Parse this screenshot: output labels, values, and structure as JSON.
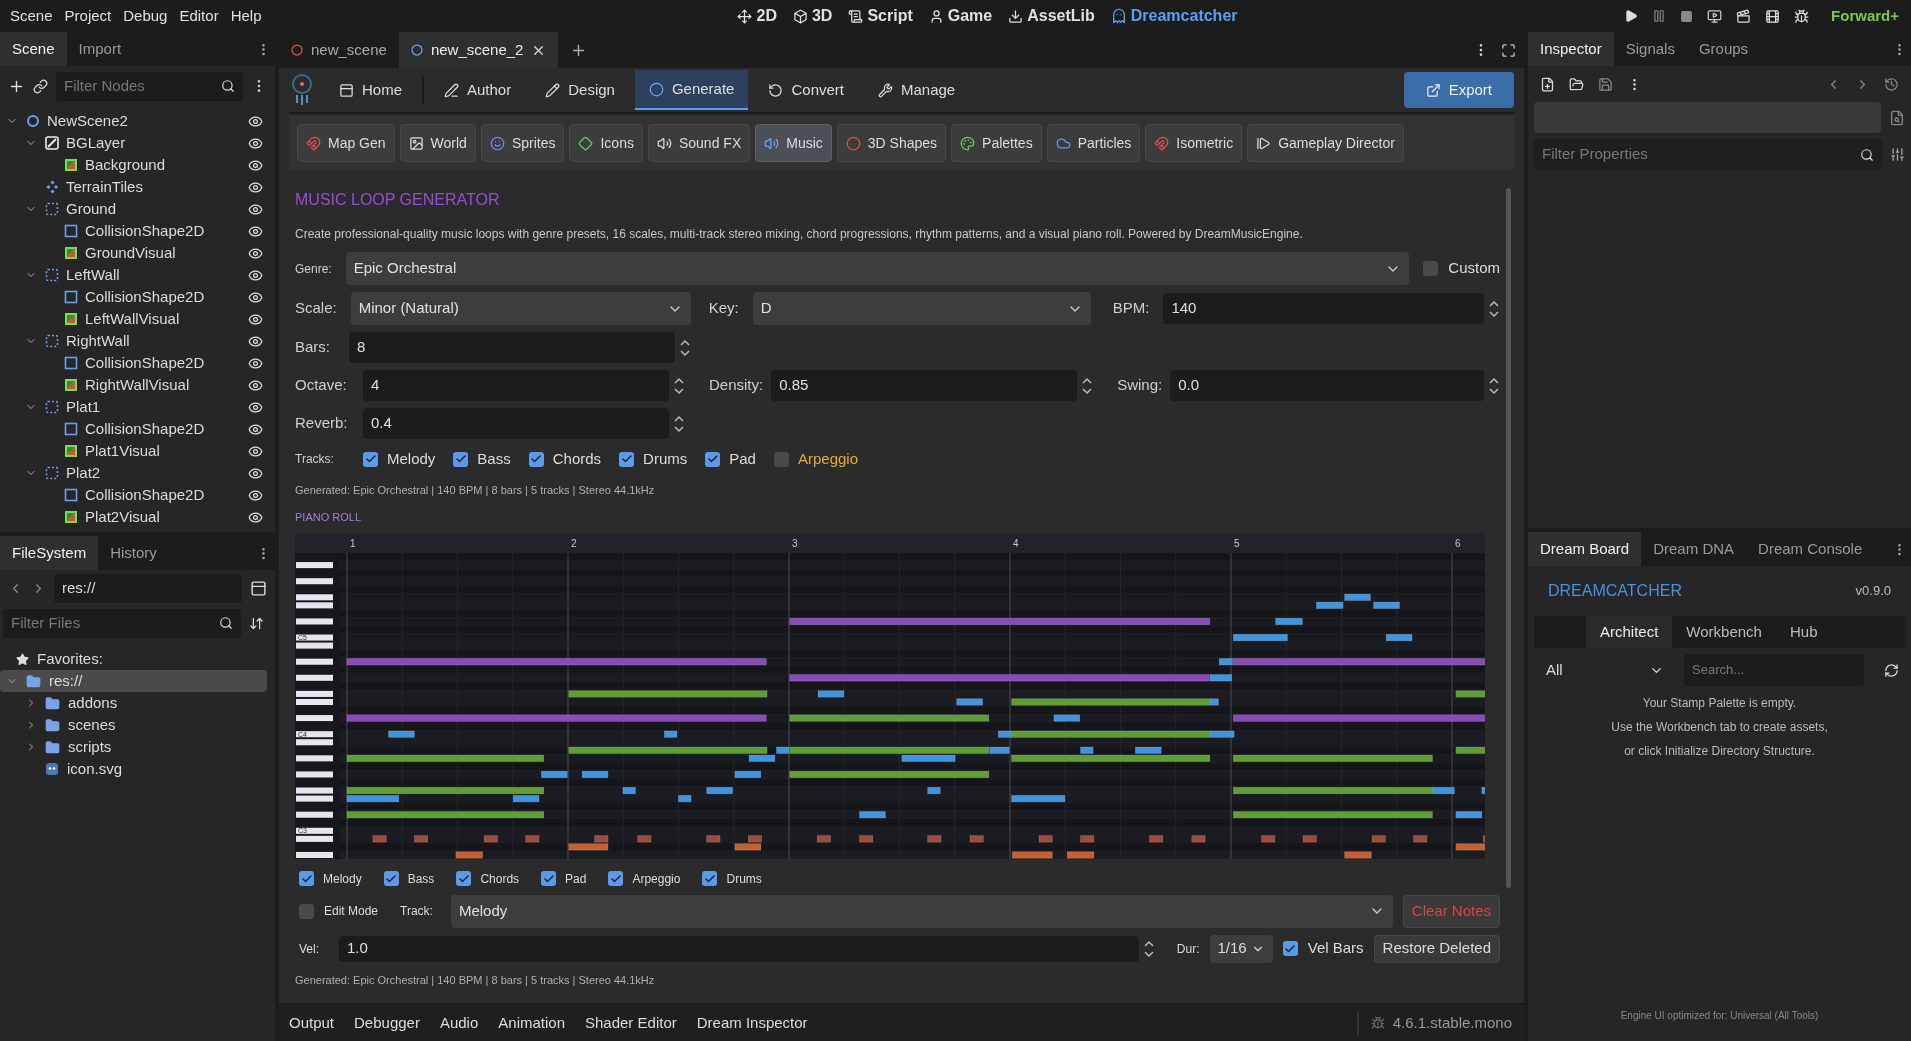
{
  "menu": [
    "Scene",
    "Project",
    "Debug",
    "Editor",
    "Help"
  ],
  "workspaces": [
    {
      "label": "2D",
      "selected": false
    },
    {
      "label": "3D",
      "selected": false
    },
    {
      "label": "Script",
      "selected": false
    },
    {
      "label": "Game",
      "selected": false
    },
    {
      "label": "AssetLib",
      "selected": false
    },
    {
      "label": "Dreamcatcher",
      "selected": true
    }
  ],
  "renderer": "Forward+",
  "scene_dock": {
    "tabs": [
      {
        "label": "Scene",
        "selected": true
      },
      {
        "label": "Import",
        "selected": false
      }
    ],
    "filter_placeholder": "Filter Nodes",
    "tree": [
      {
        "label": "NewScene2",
        "kind": "root",
        "expanded": true,
        "children": [
          {
            "label": "BGLayer",
            "kind": "layer",
            "expanded": true,
            "children": [
              {
                "label": "Background",
                "kind": "sprite"
              }
            ]
          },
          {
            "label": "TerrainTiles",
            "kind": "tilemap"
          },
          {
            "label": "Ground",
            "kind": "body",
            "expanded": true,
            "children": [
              {
                "label": "CollisionShape2D",
                "kind": "collision"
              },
              {
                "label": "GroundVisual",
                "kind": "sprite"
              }
            ]
          },
          {
            "label": "LeftWall",
            "kind": "body",
            "expanded": true,
            "children": [
              {
                "label": "CollisionShape2D",
                "kind": "collision"
              },
              {
                "label": "LeftWallVisual",
                "kind": "sprite"
              }
            ]
          },
          {
            "label": "RightWall",
            "kind": "body",
            "expanded": true,
            "children": [
              {
                "label": "CollisionShape2D",
                "kind": "collision"
              },
              {
                "label": "RightWallVisual",
                "kind": "sprite"
              }
            ]
          },
          {
            "label": "Plat1",
            "kind": "body",
            "expanded": true,
            "children": [
              {
                "label": "CollisionShape2D",
                "kind": "collision"
              },
              {
                "label": "Plat1Visual",
                "kind": "sprite"
              }
            ]
          },
          {
            "label": "Plat2",
            "kind": "body",
            "expanded": true,
            "children": [
              {
                "label": "CollisionShape2D",
                "kind": "collision"
              },
              {
                "label": "Plat2Visual",
                "kind": "sprite"
              }
            ]
          }
        ]
      }
    ]
  },
  "filesystem_dock": {
    "tabs": [
      {
        "label": "FileSystem",
        "selected": true
      },
      {
        "label": "History",
        "selected": false
      }
    ],
    "path": "res://",
    "filter_placeholder": "Filter Files",
    "favorites": "Favorites:",
    "tree": [
      {
        "label": "res://",
        "kind": "folder",
        "expanded": true,
        "selected": true,
        "children": [
          {
            "label": "addons",
            "kind": "folder",
            "expanded": false,
            "selected": false
          },
          {
            "label": "scenes",
            "kind": "folder",
            "expanded": false,
            "selected": false
          },
          {
            "label": "scripts",
            "kind": "folder",
            "expanded": false,
            "selected": false
          },
          {
            "label": "icon.svg",
            "kind": "file",
            "selected": false
          }
        ]
      }
    ]
  },
  "scene_tabs": [
    {
      "label": "new_scene",
      "selected": false
    },
    {
      "label": "new_scene_2",
      "selected": true
    }
  ],
  "plugin": {
    "nav": [
      {
        "label": "Home",
        "selected": false
      },
      {
        "label": "Author",
        "selected": false
      },
      {
        "label": "Design",
        "selected": false
      },
      {
        "label": "Generate",
        "selected": true
      },
      {
        "label": "Convert",
        "selected": false
      },
      {
        "label": "Manage",
        "selected": false
      }
    ],
    "export": "Export",
    "tools": [
      {
        "label": "Map Gen",
        "selected": false
      },
      {
        "label": "World",
        "selected": false
      },
      {
        "label": "Sprites",
        "selected": false
      },
      {
        "label": "Icons",
        "selected": false
      },
      {
        "label": "Sound FX",
        "selected": false
      },
      {
        "label": "Music",
        "selected": true
      },
      {
        "label": "3D Shapes",
        "selected": false
      },
      {
        "label": "Palettes",
        "selected": false
      },
      {
        "label": "Particles",
        "selected": false
      },
      {
        "label": "Isometric",
        "selected": false
      },
      {
        "label": "Gameplay Director",
        "selected": false
      }
    ],
    "title": "MUSIC LOOP GENERATOR",
    "description": "Create professional-quality music loops with genre presets, 16 scales, multi-track stereo mixing, chord progressions, rhythm patterns, and a visual piano roll. Powered by DreamMusicEngine.",
    "genre": {
      "label": "Genre:",
      "value": "Epic Orchestral"
    },
    "custom": {
      "label": "Custom",
      "checked": false
    },
    "scale": {
      "label": "Scale:",
      "value": "Minor (Natural)"
    },
    "key": {
      "label": "Key:",
      "value": "D"
    },
    "bpm": {
      "label": "BPM:",
      "value": "140"
    },
    "bars": {
      "label": "Bars:",
      "value": "8"
    },
    "octave": {
      "label": "Octave:",
      "value": "4"
    },
    "density": {
      "label": "Density:",
      "value": "0.85"
    },
    "swing": {
      "label": "Swing:",
      "value": "0.0"
    },
    "reverb": {
      "label": "Reverb:",
      "value": "0.4"
    },
    "tracks_label": "Tracks:",
    "tracks": [
      {
        "label": "Melody",
        "checked": true
      },
      {
        "label": "Bass",
        "checked": true
      },
      {
        "label": "Chords",
        "checked": true
      },
      {
        "label": "Drums",
        "checked": true
      },
      {
        "label": "Pad",
        "checked": true
      },
      {
        "label": "Arpeggio",
        "checked": false
      }
    ],
    "generated": "Generated: Epic Orchestral | 140 BPM | 8 bars | 5 tracks | Stereo 44.1kHz",
    "piano_roll": {
      "title": "PIANO ROLL",
      "bar_labels": [
        "1",
        "2",
        "3",
        "4",
        "5",
        "6"
      ],
      "octave_labels": [
        "C5",
        "C4",
        "C3"
      ],
      "layers": [
        {
          "label": "Melody",
          "checked": true
        },
        {
          "label": "Bass",
          "checked": true
        },
        {
          "label": "Chords",
          "checked": true
        },
        {
          "label": "Pad",
          "checked": true
        },
        {
          "label": "Arpeggio",
          "checked": true
        },
        {
          "label": "Drums",
          "checked": true
        }
      ]
    },
    "edit_mode": {
      "label": "Edit Mode",
      "checked": false
    },
    "track": {
      "label": "Track:",
      "value": "Melody"
    },
    "clear": "Clear Notes",
    "vel": {
      "label": "Vel:",
      "value": "1.0"
    },
    "dur": {
      "label": "Dur:",
      "value": "1/16"
    },
    "vel_bars": {
      "label": "Vel Bars",
      "checked": true
    },
    "restore": "Restore Deleted",
    "status": "Generated: Epic Orchestral | 140 BPM | 8 bars | 5 tracks | Stereo 44.1kHz"
  },
  "bottom_panel": {
    "tabs": [
      "Output",
      "Debugger",
      "Audio",
      "Animation",
      "Shader Editor",
      "Dream Inspector"
    ],
    "version": "4.6.1.stable.mono"
  },
  "inspector": {
    "tabs": [
      {
        "label": "Inspector",
        "selected": true
      },
      {
        "label": "Signals",
        "selected": false
      },
      {
        "label": "Groups",
        "selected": false
      }
    ],
    "filter_placeholder": "Filter Properties"
  },
  "dream_dock": {
    "tabs": [
      {
        "label": "Dream Board",
        "selected": true
      },
      {
        "label": "Dream DNA",
        "selected": false
      },
      {
        "label": "Dream Console",
        "selected": false
      }
    ],
    "title": "DREAMCATCHER",
    "version": "v0.9.0",
    "subtabs": [
      {
        "label": "Architect",
        "selected": true
      },
      {
        "label": "Workbench",
        "selected": false
      },
      {
        "label": "Hub",
        "selected": false
      }
    ],
    "filter": "All",
    "search_placeholder": "Search...",
    "empty_lines": [
      "Your Stamp Palette is empty.",
      "Use the Workbench tab to create assets,",
      "or click Initialize Directory Structure."
    ],
    "footer": "Engine UI optimized for: Universal (All Tools)"
  }
}
